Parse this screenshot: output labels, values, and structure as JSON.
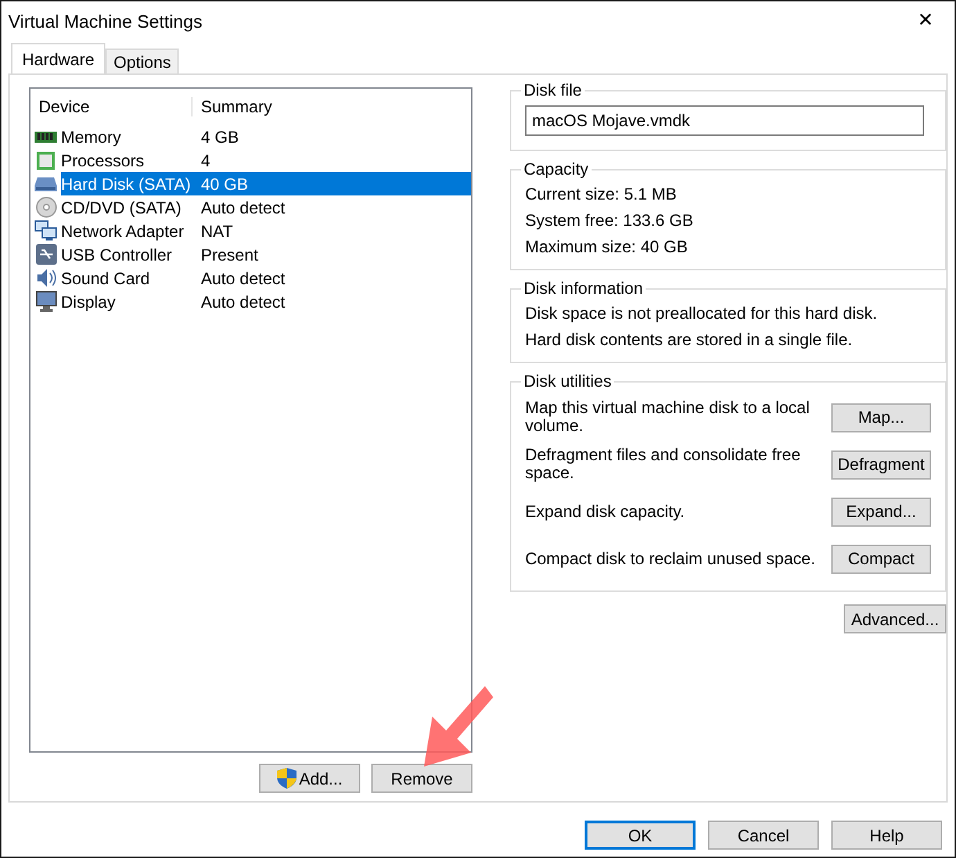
{
  "window": {
    "title": "Virtual Machine Settings",
    "close": "✕"
  },
  "tabs": [
    {
      "label": "Hardware",
      "selected": true
    },
    {
      "label": "Options",
      "selected": false
    }
  ],
  "devices": {
    "columns": [
      "Device",
      "Summary"
    ],
    "rows": [
      {
        "device": "Memory",
        "summary": "4 GB",
        "selected": false
      },
      {
        "device": "Processors",
        "summary": "4",
        "selected": false
      },
      {
        "device": "Hard Disk (SATA)",
        "summary": "40 GB",
        "selected": true
      },
      {
        "device": "CD/DVD (SATA)",
        "summary": "Auto detect",
        "selected": false
      },
      {
        "device": "Network Adapter",
        "summary": "NAT",
        "selected": false
      },
      {
        "device": "USB Controller",
        "summary": "Present",
        "selected": false
      },
      {
        "device": "Sound Card",
        "summary": "Auto detect",
        "selected": false
      },
      {
        "device": "Display",
        "summary": "Auto detect",
        "selected": false
      }
    ]
  },
  "list_buttons": [
    {
      "label": "Add...",
      "shield": true
    },
    {
      "label": "Remove",
      "shield": false
    }
  ],
  "disk_file": {
    "title": "Disk file",
    "value": "macOS Mojave.vmdk"
  },
  "capacity": {
    "title": "Capacity",
    "lines": [
      "Current size:  5.1 MB",
      "System free:  133.6 GB",
      "Maximum size:  40 GB"
    ]
  },
  "disk_information": {
    "title": "Disk information",
    "lines": [
      "Disk space is not preallocated for this hard disk.",
      "Hard disk contents are stored in a single file."
    ]
  },
  "disk_utilities": {
    "title": "Disk utilities",
    "items": [
      {
        "text": "Map this virtual machine disk to a local volume.",
        "button": "Map..."
      },
      {
        "text": "Defragment files and consolidate free space.",
        "button": "Defragment"
      },
      {
        "text": "Expand disk capacity.",
        "button": "Expand..."
      },
      {
        "text": "Compact disk to reclaim unused space.",
        "button": "Compact"
      }
    ]
  },
  "advanced_button": "Advanced...",
  "footer_buttons": [
    {
      "label": "OK",
      "default": true
    },
    {
      "label": "Cancel",
      "default": false
    },
    {
      "label": "Help",
      "default": false
    }
  ]
}
